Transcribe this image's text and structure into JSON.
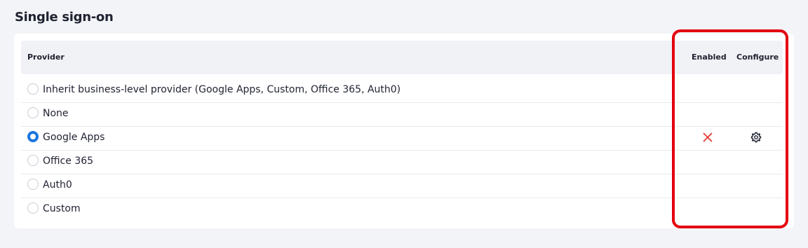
{
  "section": {
    "title": "Single sign-on"
  },
  "table": {
    "headers": {
      "provider": "Provider",
      "enabled": "Enabled",
      "configure": "Configure"
    },
    "rows": [
      {
        "label": "Inherit business-level provider (Google Apps, Custom, Office 365, Auth0)",
        "selected": false
      },
      {
        "label": "None",
        "selected": false
      },
      {
        "label": "Google Apps",
        "selected": true,
        "enabled_icon": "x-icon",
        "configure_icon": "gear-icon"
      },
      {
        "label": "Office 365",
        "selected": false
      },
      {
        "label": "Auth0",
        "selected": false
      },
      {
        "label": "Custom",
        "selected": false
      }
    ]
  },
  "colors": {
    "accent": "#1976e0",
    "disabled_x": "#e53935",
    "highlight": "#e3000f"
  }
}
